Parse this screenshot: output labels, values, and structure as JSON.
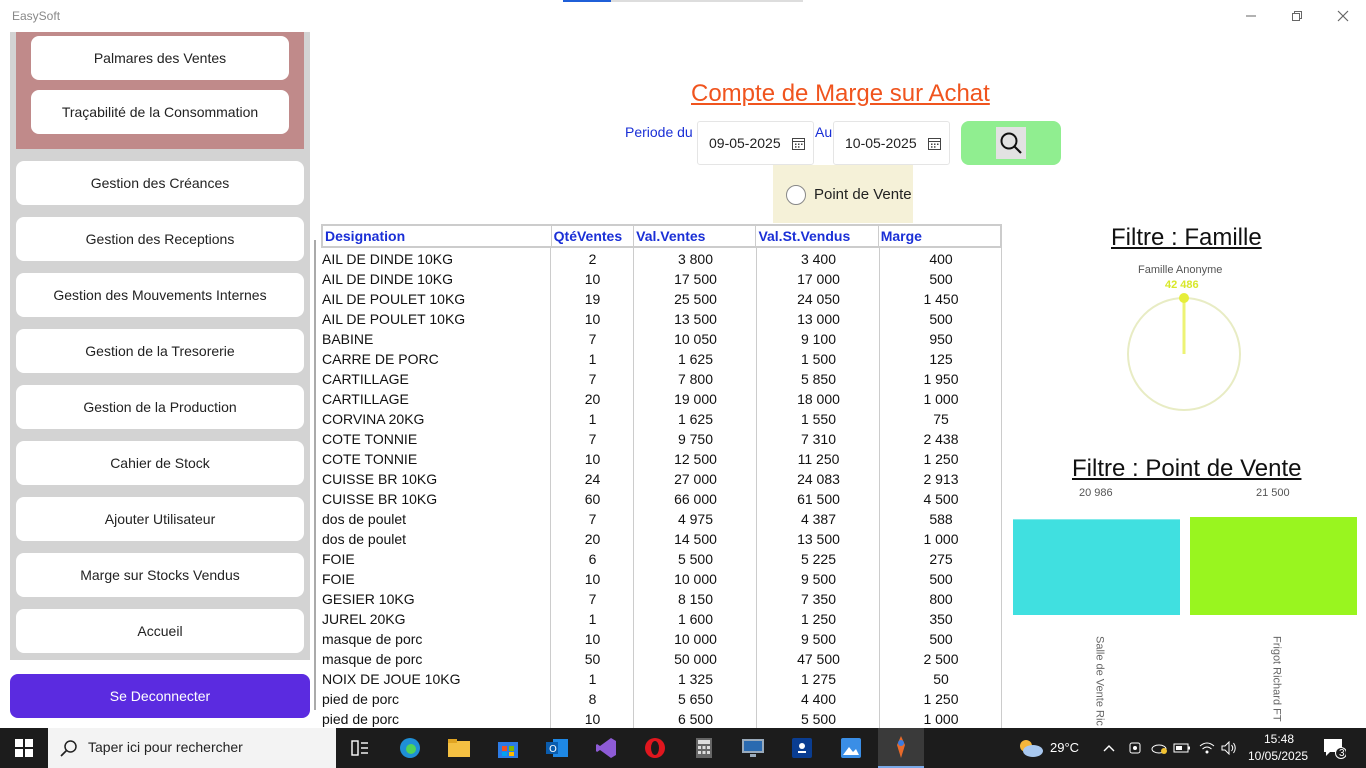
{
  "app": {
    "title": "EasySoft"
  },
  "sidebar": {
    "sub_items": [
      {
        "label": "Palmares des Ventes"
      },
      {
        "label": "Traçabilité de la Consommation"
      }
    ],
    "items": [
      {
        "label": "Gestion des Créances"
      },
      {
        "label": "Gestion des Receptions"
      },
      {
        "label": "Gestion des Mouvements Internes"
      },
      {
        "label": "Gestion de la Tresorerie"
      },
      {
        "label": "Gestion de la Production"
      },
      {
        "label": "Cahier de Stock"
      },
      {
        "label": "Ajouter Utilisateur"
      },
      {
        "label": "Marge sur Stocks Vendus"
      },
      {
        "label": "Accueil"
      }
    ],
    "logout_label": "Se Deconnecter"
  },
  "header": {
    "title": "Compte de Marge sur Achat",
    "period_from_label": "Periode du",
    "period_to_label": "Au",
    "date_from": "09-05-2025",
    "date_to": "10-05-2025",
    "radio_label": "Point de Vente"
  },
  "table": {
    "columns": [
      "Designation",
      "QtéVentes",
      "Val.Ventes",
      "Val.St.Vendus",
      "Marge"
    ],
    "rows": [
      [
        "AIL DE DINDE 10KG",
        "2",
        "3 800",
        "3 400",
        "400"
      ],
      [
        "AIL DE DINDE 10KG",
        "10",
        "17 500",
        "17 000",
        "500"
      ],
      [
        "AIL DE POULET 10KG",
        "19",
        "25 500",
        "24 050",
        "1 450"
      ],
      [
        "AIL DE POULET 10KG",
        "10",
        "13 500",
        "13 000",
        "500"
      ],
      [
        "BABINE",
        "7",
        "10 050",
        "9 100",
        "950"
      ],
      [
        "CARRE DE PORC",
        "1",
        "1 625",
        "1 500",
        "125"
      ],
      [
        "CARTILLAGE",
        "7",
        "7 800",
        "5 850",
        "1 950"
      ],
      [
        "CARTILLAGE",
        "20",
        "19 000",
        "18 000",
        "1 000"
      ],
      [
        "CORVINA 20KG",
        "1",
        "1 625",
        "1 550",
        "75"
      ],
      [
        "COTE TONNIE",
        "7",
        "9 750",
        "7 310",
        "2 438"
      ],
      [
        "COTE TONNIE",
        "10",
        "12 500",
        "11 250",
        "1 250"
      ],
      [
        "CUISSE  BR 10KG",
        "24",
        "27 000",
        "24 083",
        "2 913"
      ],
      [
        "CUISSE  BR 10KG",
        "60",
        "66 000",
        "61 500",
        "4 500"
      ],
      [
        "dos de poulet",
        "7",
        "4 975",
        "4 387",
        "588"
      ],
      [
        "dos de poulet",
        "20",
        "14 500",
        "13 500",
        "1 000"
      ],
      [
        "FOIE",
        "6",
        "5 500",
        "5 225",
        "275"
      ],
      [
        "FOIE",
        "10",
        "10 000",
        "9 500",
        "500"
      ],
      [
        "GESIER 10KG",
        "7",
        "8 150",
        "7 350",
        "800"
      ],
      [
        "JUREL 20KG",
        "1",
        "1 600",
        "1 250",
        "350"
      ],
      [
        "masque de porc",
        "10",
        "10 000",
        "9 500",
        "500"
      ],
      [
        "masque de porc",
        "50",
        "50 000",
        "47 500",
        "2 500"
      ],
      [
        "NOIX DE JOUE 10KG",
        "1",
        "1 325",
        "1 275",
        "50"
      ],
      [
        "pied de porc",
        "8",
        "5 650",
        "4 400",
        "1 250"
      ],
      [
        "pied de porc",
        "10",
        "6 500",
        "5 500",
        "1 000"
      ]
    ]
  },
  "chart_data": [
    {
      "type": "pie",
      "title": "Filtre : Famille",
      "categories": [
        "Famille Anonyme"
      ],
      "values": [
        42486
      ],
      "value_labels": [
        "42 486"
      ],
      "colors": [
        "#e6ee3a"
      ]
    },
    {
      "type": "bar",
      "title": "Filtre : Point de Vente",
      "categories": [
        "Salle de Vente Ric",
        "Frigot Richard FT"
      ],
      "values": [
        20986,
        21500
      ],
      "value_labels": [
        "20 986",
        "21 500"
      ],
      "colors": [
        "#40e0e0",
        "#99f51f"
      ]
    }
  ],
  "taskbar": {
    "search_placeholder": "Taper ici pour rechercher",
    "weather": "29°C",
    "time": "15:48",
    "date": "10/05/2025",
    "notification_count": "3"
  }
}
